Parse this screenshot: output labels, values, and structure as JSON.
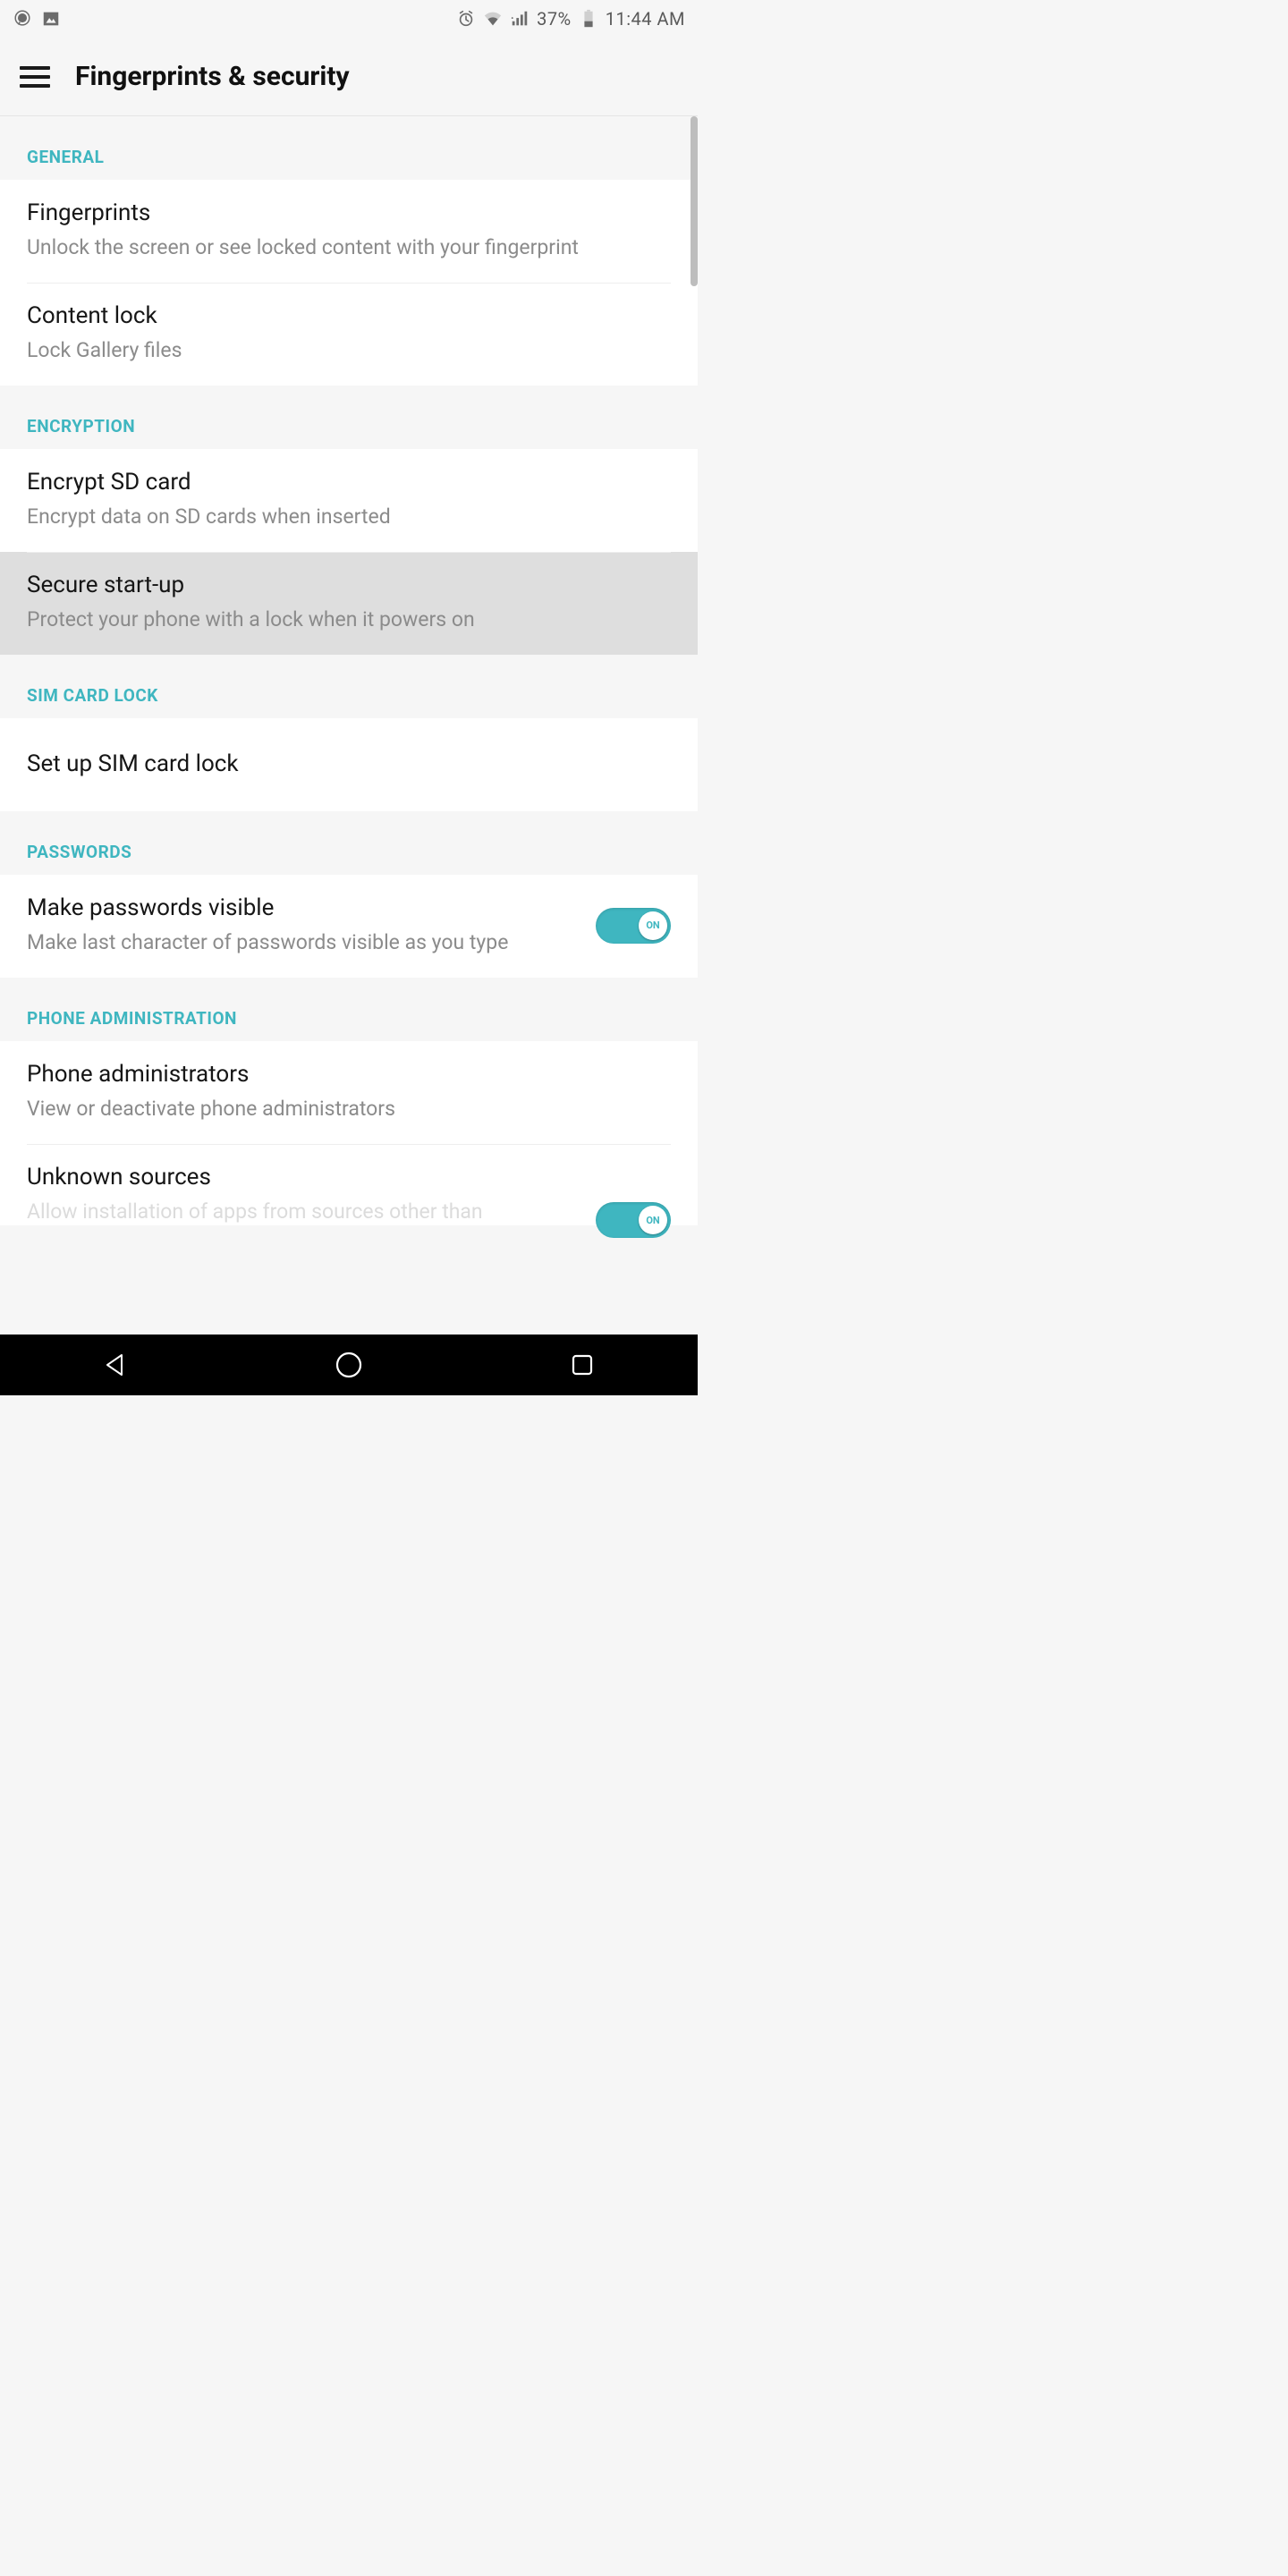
{
  "statusbar": {
    "battery_pct": "37%",
    "time": "11:44 AM"
  },
  "appbar": {
    "title": "Fingerprints & security"
  },
  "sections": {
    "general": {
      "header": "GENERAL",
      "fingerprints": {
        "title": "Fingerprints",
        "sub": "Unlock the screen or see locked content with your fingerprint"
      },
      "content_lock": {
        "title": "Content lock",
        "sub": "Lock Gallery files"
      }
    },
    "encryption": {
      "header": "ENCRYPTION",
      "encrypt_sd": {
        "title": "Encrypt SD card",
        "sub": "Encrypt data on SD cards when inserted"
      },
      "secure_startup": {
        "title": "Secure start-up",
        "sub": "Protect your phone with a lock when it powers on"
      }
    },
    "sim": {
      "header": "SIM CARD LOCK",
      "sim_lock": {
        "title": "Set up SIM card lock"
      }
    },
    "passwords": {
      "header": "PASSWORDS",
      "visible": {
        "title": "Make passwords visible",
        "sub": "Make last character of passwords visible as you type",
        "toggle": "ON"
      }
    },
    "admin": {
      "header": "PHONE ADMINISTRATION",
      "admins": {
        "title": "Phone administrators",
        "sub": "View or deactivate phone administrators"
      },
      "unknown": {
        "title": "Unknown sources",
        "sub": "Allow installation of apps from sources other than",
        "toggle": "ON"
      }
    }
  }
}
